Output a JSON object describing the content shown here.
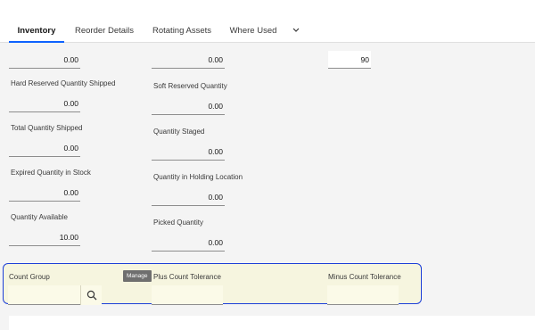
{
  "tabs": [
    {
      "label": "Inventory",
      "active": true
    },
    {
      "label": "Reorder Details",
      "active": false
    },
    {
      "label": "Rotating Assets",
      "active": false
    },
    {
      "label": "Where Used",
      "active": false
    }
  ],
  "more_tabs_icon": "chevron-down-icon",
  "col1": {
    "top_value": "0.00",
    "hard_reserved_shipped": {
      "label": "Hard Reserved Quantity Shipped",
      "value": "0.00"
    },
    "total_shipped": {
      "label": "Total Quantity Shipped",
      "value": "0.00"
    },
    "expired_in_stock": {
      "label": "Expired Quantity in Stock",
      "value": "0.00"
    },
    "available": {
      "label": "Quantity Available",
      "value": "10.00"
    }
  },
  "col2": {
    "top_value": "0.00",
    "soft_reserved": {
      "label": "Soft Reserved Quantity",
      "value": "0.00"
    },
    "staged": {
      "label": "Quantity Staged",
      "value": "0.00"
    },
    "holding": {
      "label": "Quantity in Holding Location",
      "value": "0.00"
    },
    "picked": {
      "label": "Picked Quantity",
      "value": "0.00"
    }
  },
  "col3": {
    "top_value": "90"
  },
  "count_section": {
    "count_group_label": "Count Group",
    "count_group_value": "",
    "lookup_icon": "search-icon",
    "plus_tolerance_label": "Plus Count Tolerance",
    "plus_tolerance_value": "",
    "minus_tolerance_label": "Minus Count Tolerance",
    "minus_tolerance_value": "",
    "tooltip": "Manage"
  },
  "colors": {
    "tab_underline": "#0f62fe",
    "highlight_border": "#1d3fd8",
    "highlight_fill": "#f6f5df",
    "tooltip_bg": "#6f6f6f"
  }
}
